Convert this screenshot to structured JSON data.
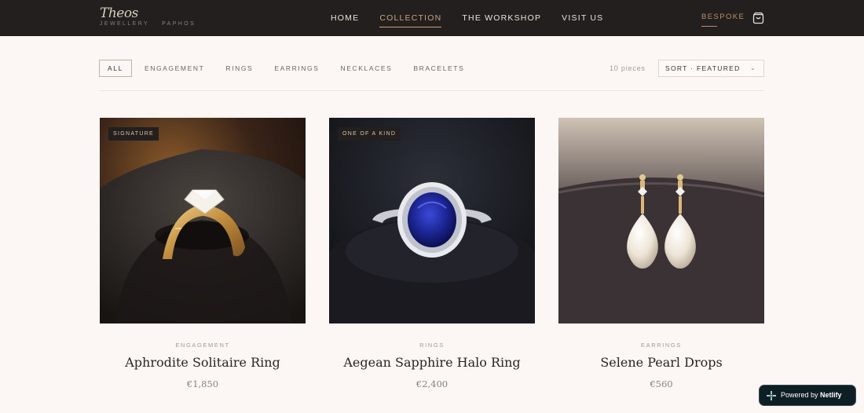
{
  "brand": {
    "logo": "Theos",
    "subtitle_left": "JEWELLERY",
    "subtitle_right": "PAPHOS"
  },
  "nav": {
    "items": [
      {
        "label": "HOME",
        "active": false
      },
      {
        "label": "COLLECTION",
        "active": true
      },
      {
        "label": "THE WORKSHOP",
        "active": false
      },
      {
        "label": "VISIT US",
        "active": false
      }
    ],
    "bespoke": "BESPOKE",
    "cart_icon": "shopping-bag-icon"
  },
  "filters": {
    "items": [
      "ALL",
      "ENGAGEMENT",
      "RINGS",
      "EARRINGS",
      "NECKLACES",
      "BRACELETS"
    ],
    "active": "ALL",
    "count": "10 pieces",
    "sort_label": "SORT · FEATURED",
    "sort_icon": "chevron-down-icon"
  },
  "products": [
    {
      "badge": "SIGNATURE",
      "category": "ENGAGEMENT",
      "name": "Aphrodite Solitaire Ring",
      "price": "€1,850"
    },
    {
      "badge": "ONE OF A KIND",
      "category": "RINGS",
      "name": "Aegean Sapphire Halo Ring",
      "price": "€2,400"
    },
    {
      "badge": "",
      "category": "EARRINGS",
      "name": "Selene Pearl Drops",
      "price": "€560"
    }
  ],
  "netlify": {
    "prefix": "Powered by",
    "brand": "Netlify"
  },
  "colors": {
    "header_bg": "#221f1e",
    "page_bg": "#fcf6f4",
    "accent_gold": "#c9a678",
    "text_dark": "#2a2522"
  }
}
